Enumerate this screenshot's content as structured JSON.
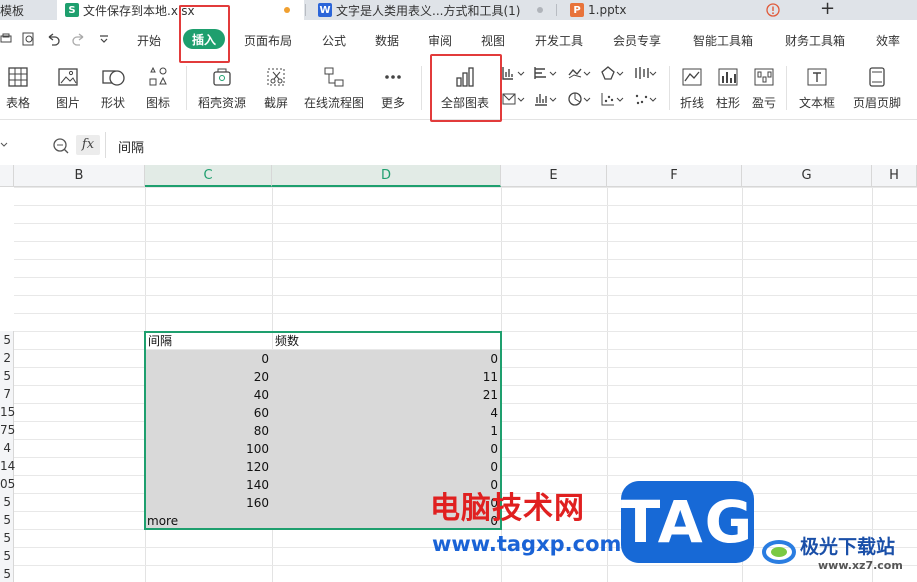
{
  "tabs": [
    {
      "label": "模板"
    },
    {
      "label": "文件保存到本地.xlsx",
      "icon": "S",
      "color": "#1e9f6e"
    },
    {
      "label": "文字是人类用表义...方式和工具(1)",
      "icon": "W",
      "color": "#2b65d9"
    },
    {
      "label": "1.pptx",
      "icon": "P",
      "color": "#e8733a"
    }
  ],
  "menu": [
    "开始",
    "插入",
    "页面布局",
    "公式",
    "数据",
    "审阅",
    "视图",
    "开发工具",
    "会员专享",
    "智能工具箱",
    "财务工具箱",
    "效率"
  ],
  "ribbon": {
    "items": [
      "表格",
      "图片",
      "形状",
      "图标",
      "稻壳资源",
      "截屏",
      "在线流程图",
      "更多",
      "全部图表",
      "折线",
      "柱形",
      "盈亏",
      "文本框",
      "页眉页脚"
    ]
  },
  "formula": {
    "content": "间隔"
  },
  "grid": {
    "columns": [
      "B",
      "C",
      "D",
      "E",
      "F",
      "G",
      "H"
    ],
    "row_labels_fragment": [
      "5",
      "2",
      "5",
      "7",
      "15",
      "75",
      "4",
      "14",
      "05",
      "5",
      "5",
      "5",
      "5",
      "5"
    ],
    "table_header": [
      "间隔",
      "频数"
    ],
    "rows": [
      {
        "c": "0",
        "d": "0"
      },
      {
        "c": "20",
        "d": "11"
      },
      {
        "c": "40",
        "d": "21"
      },
      {
        "c": "60",
        "d": "4"
      },
      {
        "c": "80",
        "d": "1"
      },
      {
        "c": "100",
        "d": "0"
      },
      {
        "c": "120",
        "d": "0"
      },
      {
        "c": "140",
        "d": "0"
      },
      {
        "c": "160",
        "d": "0"
      },
      {
        "c": "more",
        "d": "0"
      }
    ]
  },
  "watermark": {
    "title": "电脑技术网",
    "url": "www.tagxp.com",
    "logo": "TAG",
    "site": "极光下载站",
    "site_url": "www.xz7.com"
  }
}
